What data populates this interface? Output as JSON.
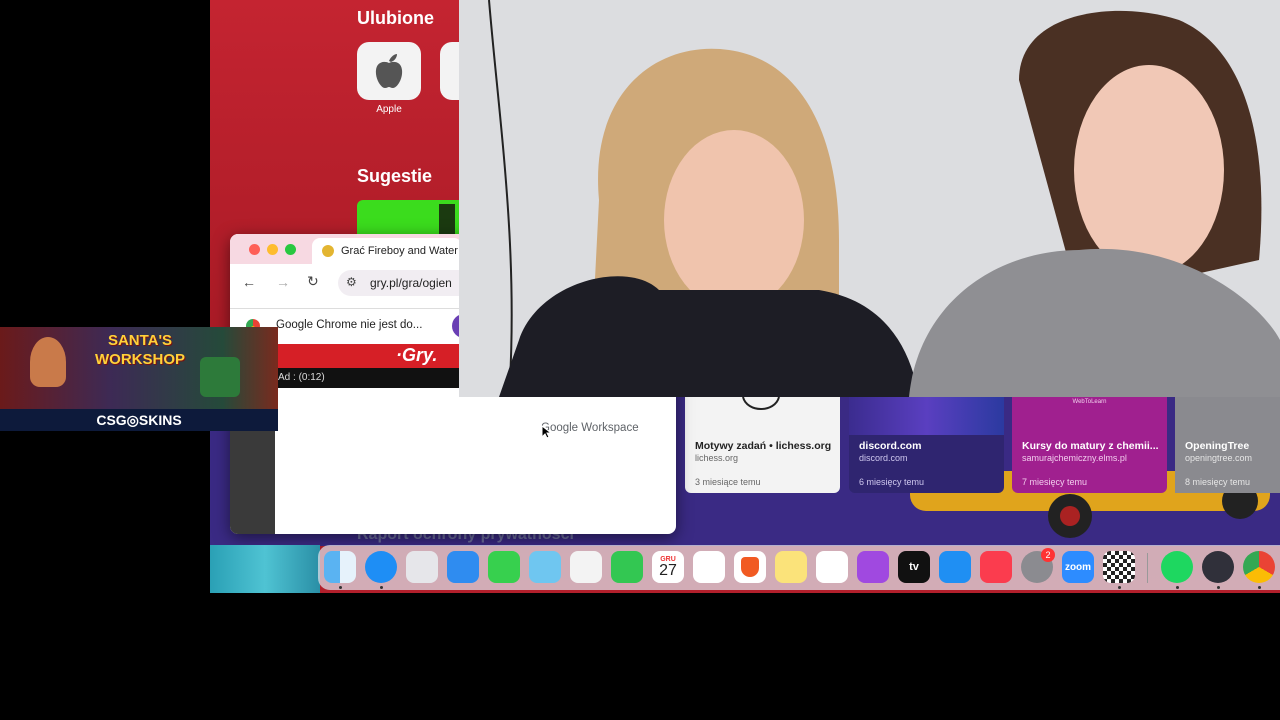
{
  "safari": {
    "favorites_title": "Ulubione",
    "favorites": [
      {
        "label": "Apple",
        "icon": "apple-icon"
      }
    ],
    "suggestions_title": "Sugestie",
    "privacy_report_label": "Raport ochrony prywatności",
    "cards": [
      {
        "title": "Motywy zadań • lichess.org",
        "domain": "lichess.org",
        "time": "3 miesiące temu"
      },
      {
        "title": "discord.com",
        "domain": "discord.com",
        "time": "6 miesięcy temu"
      },
      {
        "title": "Kursy do matury z chemii...",
        "domain": "samurajchemiczny.elms.pl",
        "time": "7 miesięcy temu",
        "thumb_label": "WebToLearn"
      },
      {
        "title": "OpeningTree",
        "domain": "openingtree.com",
        "time": "8 miesięcy temu"
      }
    ]
  },
  "chrome": {
    "tab_title": "Grać Fireboy and Water",
    "url": "gry.pl/gra/ogien",
    "infobar_text": "Google Chrome nie jest do...",
    "banner_text": "·Gry.",
    "ad_timer": "Ad : (0:12)",
    "workspace_logo": "Google Workspace"
  },
  "ad": {
    "title_line1": "SANTA'S",
    "title_line2": "WORKSHOP",
    "brand": "CSG◎SKINS"
  },
  "dock": {
    "calendar_month": "GRU",
    "calendar_day": "27",
    "settings_badge": "2",
    "zoom_label": "zoom",
    "tv_label": "tv"
  },
  "colors": {
    "safari_red": "#b81f2a",
    "card_purple": "#3a2a84",
    "card_magenta": "#a0208f",
    "chrome_tab_pink": "#f7d9e2"
  }
}
